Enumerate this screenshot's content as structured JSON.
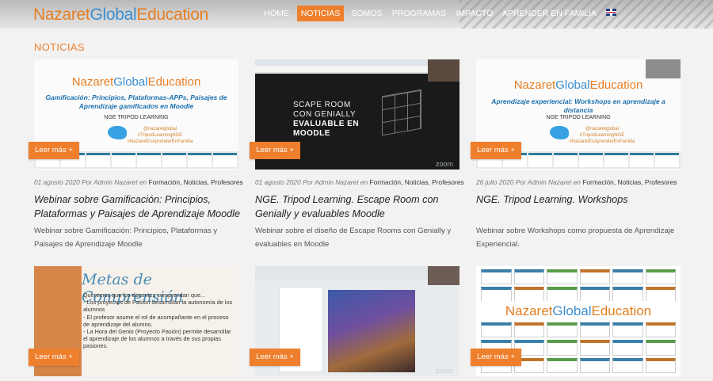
{
  "header": {
    "logo": {
      "part1": "Nazaret",
      "part2": "Global",
      "part3": "Education"
    },
    "nav": [
      {
        "label": "HOME",
        "active": false
      },
      {
        "label": "NOTICIAS",
        "active": true
      },
      {
        "label": "SOMOS",
        "active": false
      },
      {
        "label": "PROGRAMAS",
        "active": false
      },
      {
        "label": "IMPACTO",
        "active": false
      },
      {
        "label": "APRENDER EN FAMILIA",
        "active": false
      }
    ],
    "language_icon": "uk-flag-icon"
  },
  "page_title": "NOTICIAS",
  "read_more_label": "Leer más +",
  "posts": [
    {
      "date": "01 agosto 2020",
      "by": "Por",
      "author": "Admin Nazaret",
      "in": "en",
      "categories": "Formación, Noticias, Profesores",
      "title": "Webinar sobre Gamificación: Principios, Plataformas y Paisajes de Aprendizaje Moodle",
      "excerpt": "Webinar sobre Gamificación: Principios, Plataformas y Paisajes de Aprendizaje Moodle",
      "thumb": {
        "brand_a": "Nazaret",
        "brand_b": "Global",
        "brand_c": "Education",
        "subtitle": "Gamificación: Principios, Plataformas-APPs, Paisajes de Aprendizaje gamificados en Moodle",
        "line": "NGE TRIPOD LEARNING",
        "handles": "@nazaretglobal\n#TripodLearningNGE\n#NazaretEsAprenderEnFamilia"
      }
    },
    {
      "date": "01 agosto 2020",
      "by": "Por",
      "author": "Admin Nazaret",
      "in": "en",
      "categories": "Formación, Noticias, Profesores",
      "title": "NGE. Tripod Learning. Escape Room con Genially y evaluables Moodle",
      "excerpt": "Webinar sobre el diseño de Escape Rooms con Genially y evaluables en Moodle",
      "thumb": {
        "line1": "SCAPE ROOM",
        "line2": "CON GENIALLY",
        "line3": "EVALUABLE EN",
        "line4": "MOODLE",
        "zoom": "zoom"
      }
    },
    {
      "date": "26 julio 2020",
      "by": "Por",
      "author": "Admin Nazaret",
      "in": "en",
      "categories": "Formación, Noticias, Profesores",
      "title": "NGE. Tripod Learning. Workshops",
      "excerpt": "Webinar sobre Workshops como propuesta de Aprendizaje Experiencial.",
      "thumb": {
        "brand_a": "Nazaret",
        "brand_b": "Global",
        "brand_c": "Education",
        "subtitle": "Aprendizaje experiencial: Workshops en aprendizaje a distancia",
        "line": "NGE TRIPOD LEARNING",
        "handles": "@nazaretglobal\n#TripodLearningNGE\n#NazaretEsAprenderEnFamilia"
      }
    },
    {
      "thumb": {
        "title": "Metas de Comprensión",
        "body": "Queremos que los docentes comprendan que...\n- Los proyectos de Pasión desarrollan la autonomía de los alumnos\n- El profesor asume el rol de acompañante en el proceso de aprendizaje del alumno.\n- La Hora del Genio (Proyecto Pasión) permite desarrollar el aprendizaje de los alumnos a través de sus propias pasiones."
      }
    },
    {
      "thumb": {
        "zoom": "zoom"
      }
    },
    {
      "thumb": {
        "brand_a": "Nazaret",
        "brand_b": "Global",
        "brand_c": "Education"
      }
    }
  ]
}
